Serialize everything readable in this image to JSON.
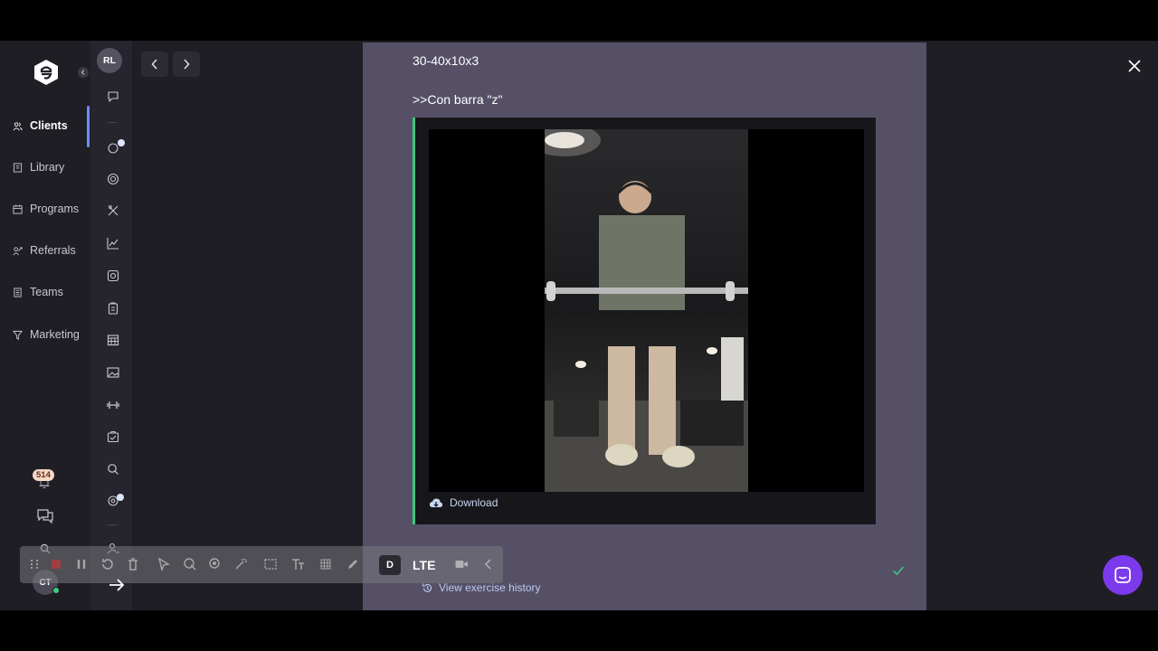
{
  "nav": {
    "items": [
      {
        "label": "Clients",
        "icon": "users-icon",
        "active": true
      },
      {
        "label": "Library",
        "icon": "book-icon"
      },
      {
        "label": "Programs",
        "icon": "calendar-icon"
      },
      {
        "label": "Referrals",
        "icon": "referral-icon"
      },
      {
        "label": "Teams",
        "icon": "building-icon"
      },
      {
        "label": "Marketing",
        "icon": "funnel-icon"
      }
    ],
    "notifications_count": "514",
    "user_initials": "CT"
  },
  "rail": {
    "client_initials": "RL"
  },
  "panel": {
    "sets_text": "30-40x10x3",
    "note_text": ">>Con barra \"z\"",
    "download_label": "Download",
    "history_label": "View exercise history"
  },
  "toolbar": {
    "d_label": "D",
    "lte_label": "LTE"
  },
  "colors": {
    "accent_green": "#3fc67f",
    "active_blue": "#6b8ef0",
    "chat_purple": "#7c3aed",
    "panel_bg": "#565066"
  }
}
